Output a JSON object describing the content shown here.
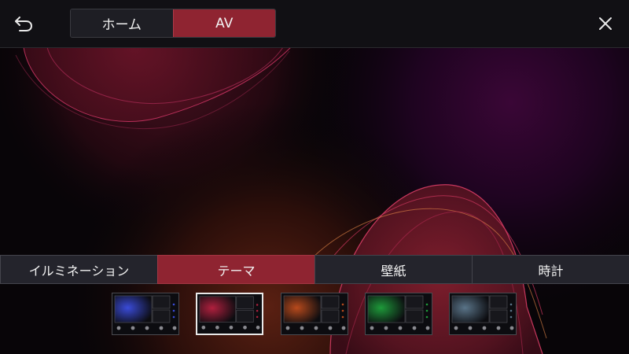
{
  "header": {
    "back_icon": "back-arrow-icon",
    "close_icon": "close-icon",
    "mode_tabs": [
      {
        "label": "ホーム",
        "active": false
      },
      {
        "label": "AV",
        "active": true
      }
    ]
  },
  "category_tabs": [
    {
      "label": "イルミネーション",
      "active": false
    },
    {
      "label": "テーマ",
      "active": true
    },
    {
      "label": "壁紙",
      "active": false
    },
    {
      "label": "時計",
      "active": false
    }
  ],
  "themes": [
    {
      "name": "blue-theme",
      "accent": "#3a4bd8",
      "selected": false
    },
    {
      "name": "red-theme",
      "accent": "#b0203e",
      "selected": true
    },
    {
      "name": "orange-theme",
      "accent": "#b84a1c",
      "selected": false
    },
    {
      "name": "green-theme",
      "accent": "#1e9a3a",
      "selected": false
    },
    {
      "name": "gray-theme",
      "accent": "#5a7488",
      "selected": false
    }
  ],
  "colors": {
    "active_tab": "#8f2431",
    "inactive_tab": "#24242c"
  }
}
